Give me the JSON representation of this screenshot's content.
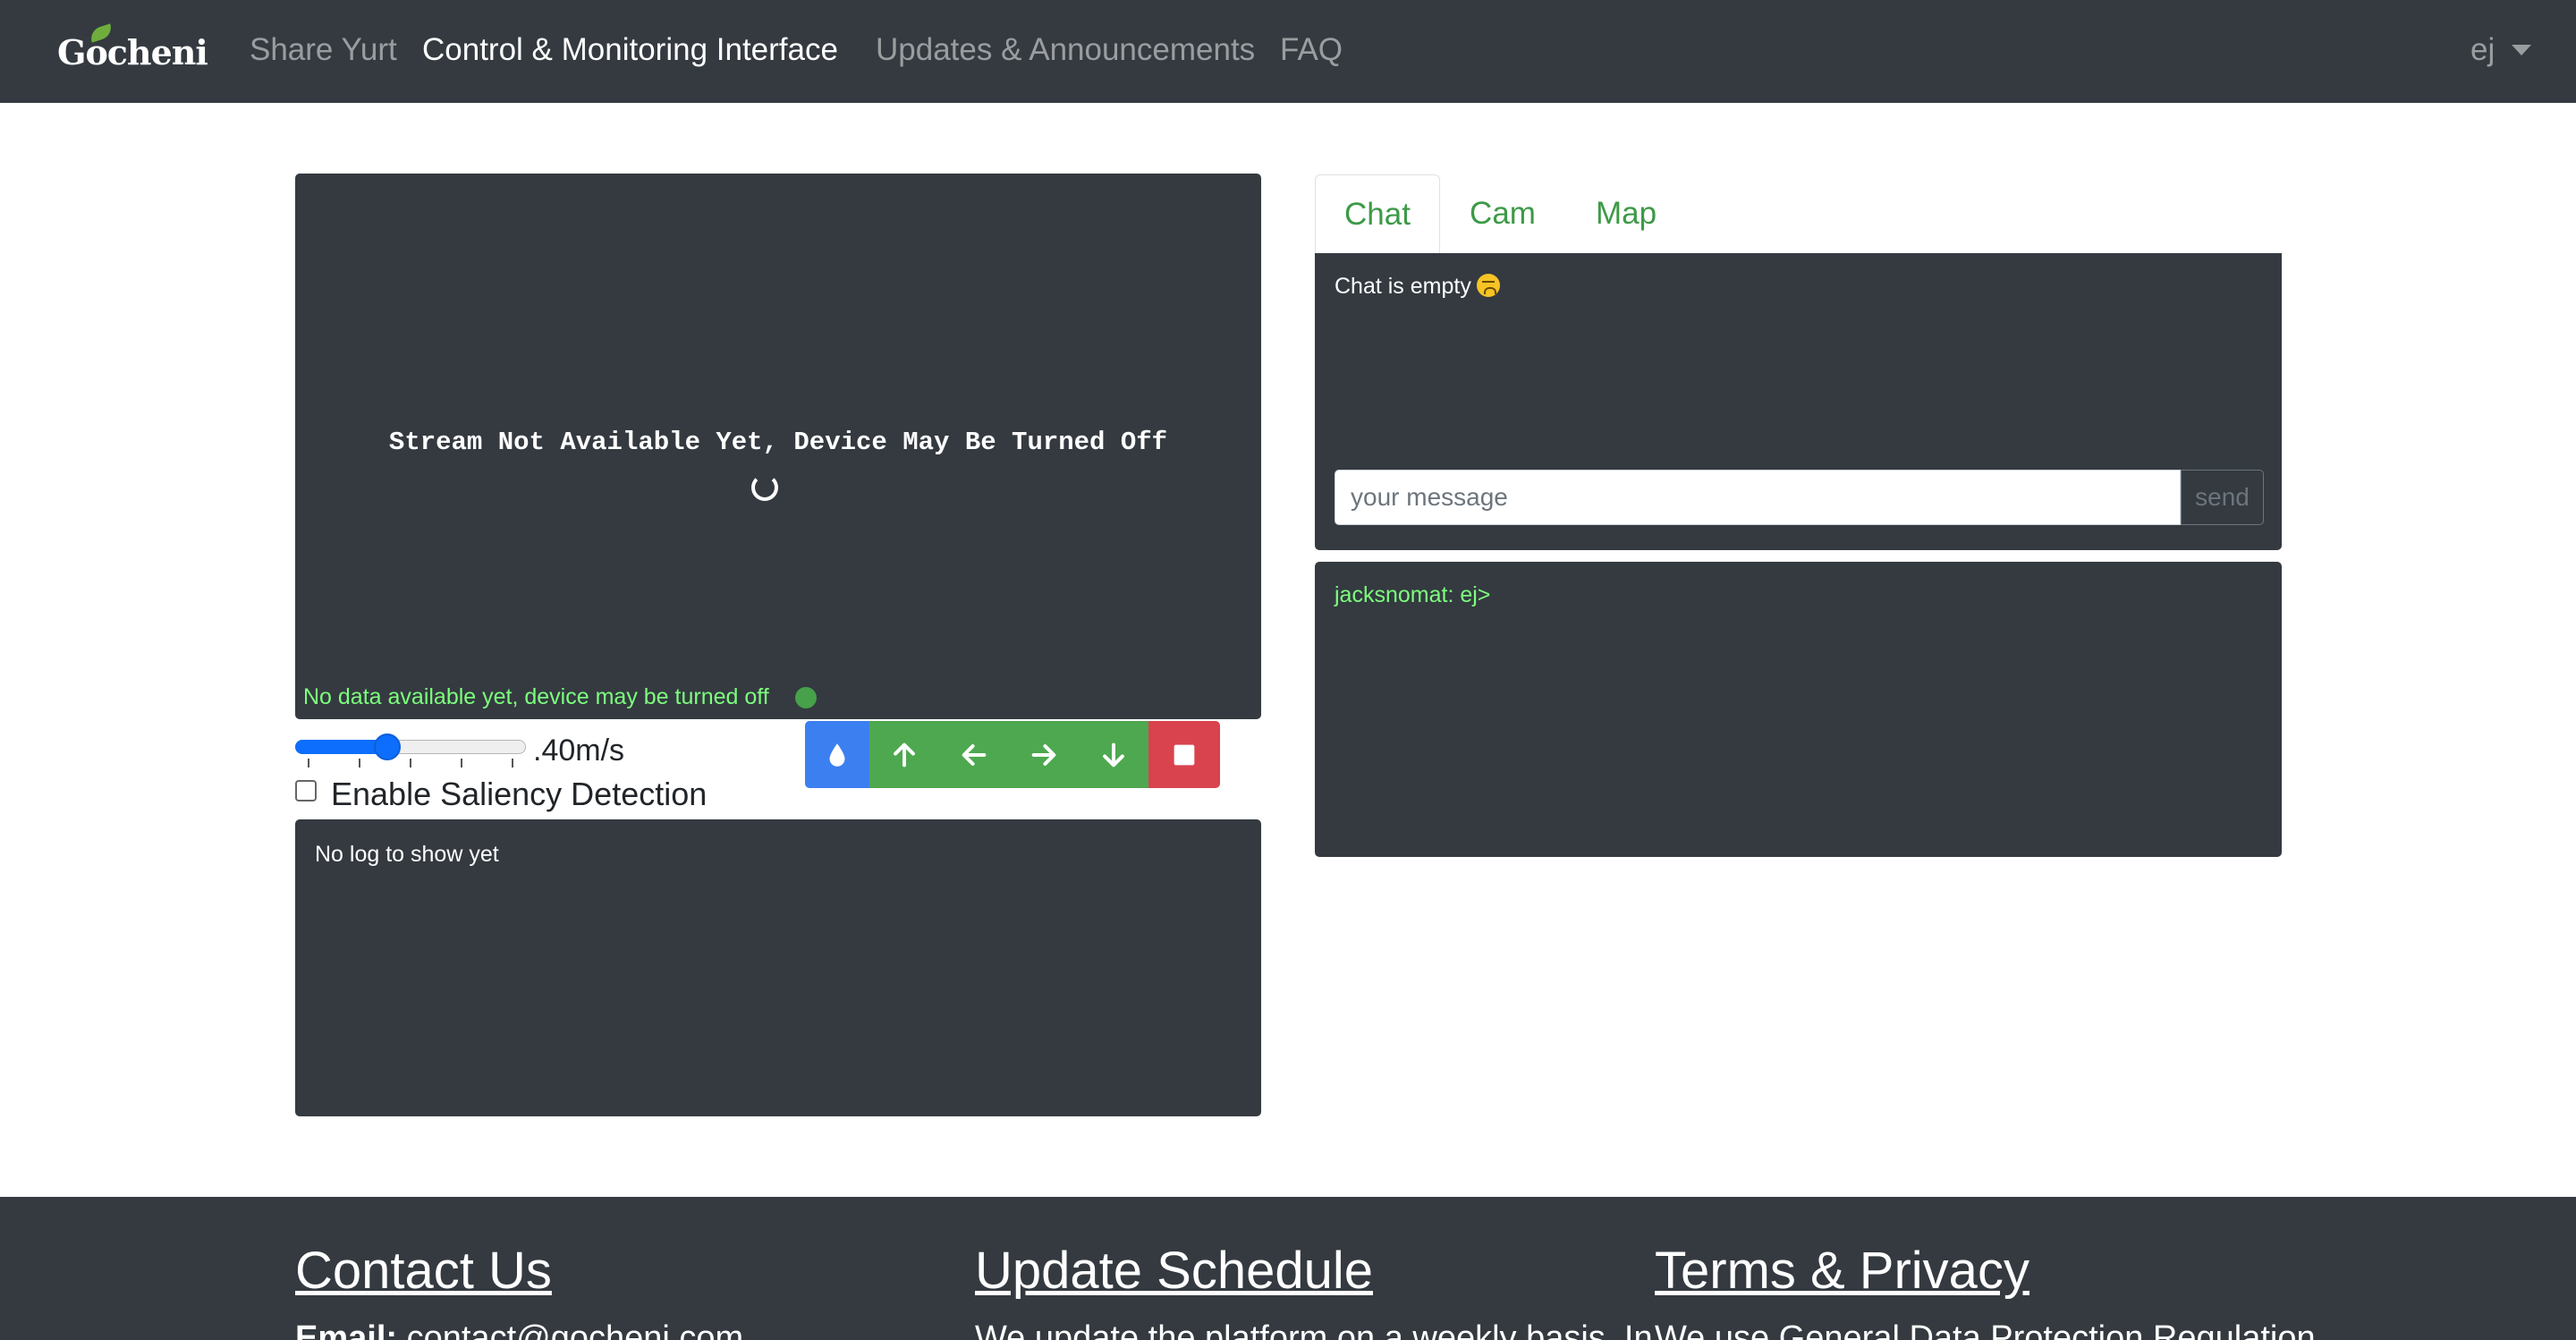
{
  "navbar": {
    "brand": "Gocheni",
    "links": [
      "Share Yurt",
      "Control & Monitoring Interface",
      "Updates & Announcements",
      "FAQ"
    ],
    "active_link": "Control & Monitoring Interface",
    "user": "ej"
  },
  "stream": {
    "message": "Stream Not Available Yet, Device May Be Turned Off",
    "status": "No data available yet, device may be turned off",
    "status_color": "#47a04a"
  },
  "controls": {
    "speed": {
      "value": 0.4,
      "max": 1.0,
      "label": ".40m/s"
    },
    "saliency_label": "Enable Saliency Detection",
    "saliency_checked": false,
    "buttons": [
      "water-icon",
      "arrow-up-icon",
      "arrow-left-icon",
      "arrow-right-icon",
      "arrow-down-icon",
      "stop-icon"
    ],
    "colors": {
      "water": "#3c7ff0",
      "move": "#4ea84f",
      "stop": "#d9434e"
    }
  },
  "log": {
    "text": "No log to show yet"
  },
  "tabs": [
    "Chat",
    "Cam",
    "Map"
  ],
  "chat": {
    "empty_text": "Chat is empty",
    "input_placeholder": "your message",
    "send_label": "send",
    "console_line": "jacksnomat: ej>"
  },
  "footer": {
    "contact": {
      "heading": "Contact Us",
      "email_label": "Email:",
      "email": "contact@gocheni.com"
    },
    "schedule": {
      "heading": "Update Schedule",
      "text": "We update the platform on a weekly basis. In"
    },
    "privacy": {
      "heading": "Terms & Privacy",
      "text": "We use General Data Protection Regulation"
    }
  }
}
